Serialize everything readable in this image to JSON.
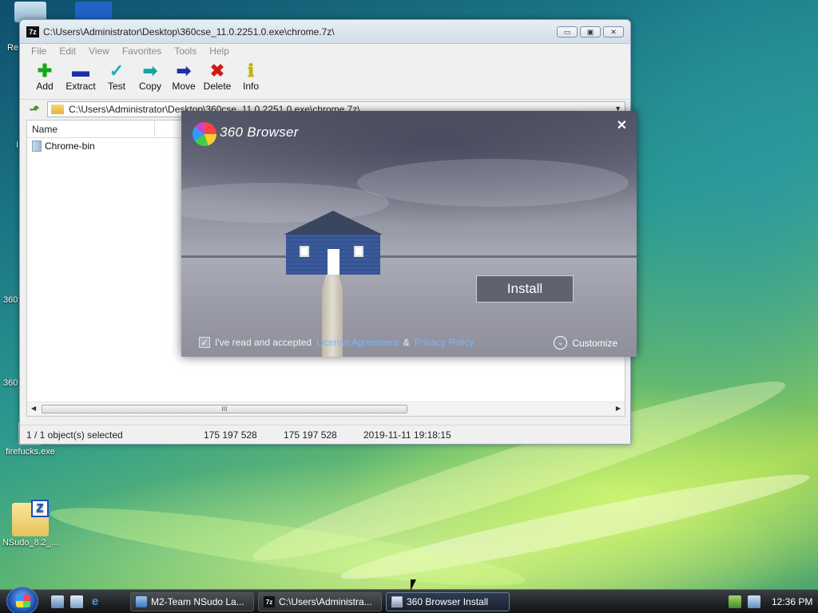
{
  "desktop": {
    "icons": [
      {
        "label": "firefucks.exe"
      },
      {
        "label": "NSudo_8.2_..."
      }
    ],
    "partial_labels": [
      "Re",
      "I",
      "360",
      "360"
    ]
  },
  "sevenzip": {
    "title": "C:\\Users\\Administrator\\Desktop\\360cse_11.0.2251.0.exe\\chrome.7z\\",
    "app_icon_text": "7z",
    "window_buttons": {
      "minimize": "▭",
      "maximize": "▣",
      "close": "✕"
    },
    "menu": [
      "File",
      "Edit",
      "View",
      "Favorites",
      "Tools",
      "Help"
    ],
    "toolbar": [
      {
        "label": "Add",
        "icon": "plus-icon",
        "glyph": "✚",
        "color": "#16a816"
      },
      {
        "label": "Extract",
        "icon": "minus-icon",
        "glyph": "▬",
        "color": "#1c2fa8"
      },
      {
        "label": "Test",
        "icon": "check-icon",
        "glyph": "✓",
        "color": "#18b0b8"
      },
      {
        "label": "Copy",
        "icon": "double-arrow-icon",
        "glyph": "➡",
        "color": "#14a6a0"
      },
      {
        "label": "Move",
        "icon": "arrow-right-icon",
        "glyph": "➡",
        "color": "#1c2fa8"
      },
      {
        "label": "Delete",
        "icon": "x-icon",
        "glyph": "✖",
        "color": "#d01818"
      },
      {
        "label": "Info",
        "icon": "info-icon",
        "glyph": "ℹ",
        "color": "#c8b000"
      }
    ],
    "address": "C:\\Users\\Administrator\\Desktop\\360cse_11.0.2251.0.exe\\chrome.7z\\",
    "columns": [
      "Name"
    ],
    "files": [
      {
        "name": "Chrome-bin"
      }
    ],
    "scroll_thumb": "III",
    "status": {
      "selected": "1 / 1 object(s) selected",
      "size": "175 197 528",
      "packed": "175 197 528",
      "modified": "2019-11-11 19:18:15"
    }
  },
  "installer": {
    "title": "360 Browser",
    "close": "✕",
    "install_button": "Install",
    "agree_prefix": "I've read and accepted",
    "license_link": "License Agreement",
    "amp": "&",
    "privacy_link": "Privacy Policy",
    "checkbox_checked": true,
    "checkmark": "✓",
    "customize": "Customize",
    "customize_glyph": "⌄"
  },
  "taskbar": {
    "tasks": [
      {
        "label": "M2-Team NSudo La...",
        "active": false
      },
      {
        "label": "C:\\Users\\Administra...",
        "active": false
      },
      {
        "label": "360 Browser Install",
        "active": true
      }
    ],
    "clock": "12:36 PM"
  }
}
